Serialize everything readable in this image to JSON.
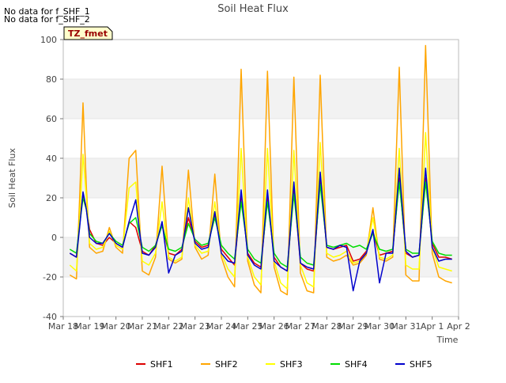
{
  "chart_data": {
    "type": "line",
    "title": "Soil Heat Flux",
    "xlabel": "Time",
    "ylabel": "Soil Heat Flux",
    "no_data_notes": [
      "No data for f_SHF_1",
      "No data for f_SHF_2"
    ],
    "tag": "TZ_fmet",
    "ylim": [
      -40,
      100
    ],
    "yticks": [
      -40,
      -20,
      0,
      20,
      40,
      60,
      80,
      100
    ],
    "xlim": [
      0,
      15
    ],
    "xticks": [
      {
        "label": "Mar 18",
        "day": 0
      },
      {
        "label": "Mar 19",
        "day": 1
      },
      {
        "label": "Mar 20",
        "day": 2
      },
      {
        "label": "Mar 21",
        "day": 3
      },
      {
        "label": "Mar 22",
        "day": 4
      },
      {
        "label": "Mar 23",
        "day": 5
      },
      {
        "label": "Mar 24",
        "day": 6
      },
      {
        "label": "Mar 25",
        "day": 7
      },
      {
        "label": "Mar 26",
        "day": 8
      },
      {
        "label": "Mar 27",
        "day": 9
      },
      {
        "label": "Mar 28",
        "day": 10
      },
      {
        "label": "Mar 29",
        "day": 11
      },
      {
        "label": "Mar 30",
        "day": 12
      },
      {
        "label": "Mar 31",
        "day": 13
      },
      {
        "label": "Apr 1",
        "day": 14
      },
      {
        "label": "Apr 2",
        "day": 15
      }
    ],
    "grid": "horizontal bands",
    "legend_position": "bottom",
    "series": [
      {
        "name": "SHF1",
        "color": "#dd0000",
        "x": [
          0.25,
          0.5,
          0.62,
          0.75,
          0.88,
          1.0,
          1.25,
          1.5,
          1.75,
          2.0,
          2.25,
          2.5,
          2.75,
          3.0,
          3.25,
          3.5,
          3.75,
          4.0,
          4.25,
          4.5,
          4.75,
          5.0,
          5.25,
          5.5,
          5.75,
          6.0,
          6.25,
          6.5,
          6.75,
          7.0,
          7.25,
          7.5,
          7.75,
          8.0,
          8.25,
          8.5,
          8.75,
          9.0,
          9.25,
          9.5,
          9.75,
          10.0,
          10.25,
          10.5,
          10.75,
          11.0,
          11.25,
          11.5,
          11.75,
          12.0,
          12.25,
          12.5,
          12.75,
          13.0,
          13.25,
          13.5,
          13.75,
          14.0,
          14.25,
          14.5,
          14.75
        ],
        "values": [
          -8,
          -10,
          8,
          22,
          15,
          4,
          -3,
          -4,
          0,
          -3,
          -5,
          8,
          5,
          -7,
          -9,
          -4,
          7,
          -8,
          -9,
          -6,
          10,
          -2,
          -5,
          -4,
          12,
          -6,
          -10,
          -14,
          22,
          -8,
          -13,
          -15,
          20,
          -10,
          -15,
          -17,
          25,
          -13,
          -16,
          -17,
          30,
          -5,
          -6,
          -5,
          -4,
          -12,
          -11,
          -7,
          3,
          -9,
          -8,
          -7,
          30,
          -8,
          -10,
          -9,
          30,
          -3,
          -10,
          -10,
          -11
        ]
      },
      {
        "name": "SHF2",
        "color": "#ffa500",
        "x": [
          0.25,
          0.5,
          0.62,
          0.75,
          0.88,
          1.0,
          1.25,
          1.5,
          1.75,
          2.0,
          2.25,
          2.5,
          2.75,
          3.0,
          3.25,
          3.5,
          3.75,
          4.0,
          4.25,
          4.5,
          4.75,
          5.0,
          5.25,
          5.5,
          5.75,
          6.0,
          6.25,
          6.5,
          6.75,
          7.0,
          7.25,
          7.5,
          7.75,
          8.0,
          8.25,
          8.5,
          8.75,
          9.0,
          9.25,
          9.5,
          9.75,
          10.0,
          10.25,
          10.5,
          10.75,
          11.0,
          11.25,
          11.5,
          11.75,
          12.0,
          12.25,
          12.5,
          12.75,
          13.0,
          13.25,
          13.5,
          13.75,
          14.0,
          14.25,
          14.5,
          14.75
        ],
        "values": [
          -19,
          -21,
          20,
          68,
          25,
          -5,
          -8,
          -7,
          5,
          -5,
          -8,
          40,
          44,
          -17,
          -19,
          -10,
          36,
          -11,
          -13,
          -11,
          34,
          -5,
          -11,
          -9,
          32,
          -10,
          -20,
          -25,
          85,
          -12,
          -24,
          -28,
          84,
          -15,
          -27,
          -29,
          81,
          -18,
          -27,
          -28,
          82,
          -10,
          -12,
          -11,
          -9,
          -14,
          -13,
          -9,
          15,
          -11,
          -12,
          -10,
          86,
          -19,
          -22,
          -22,
          97,
          -8,
          -20,
          -22,
          -23
        ]
      },
      {
        "name": "SHF3",
        "color": "#ffff00",
        "x": [
          0.25,
          0.5,
          0.62,
          0.75,
          0.88,
          1.0,
          1.25,
          1.5,
          1.75,
          2.0,
          2.25,
          2.5,
          2.75,
          3.0,
          3.25,
          3.5,
          3.75,
          4.0,
          4.25,
          4.5,
          4.75,
          5.0,
          5.25,
          5.5,
          5.75,
          6.0,
          6.25,
          6.5,
          6.75,
          7.0,
          7.25,
          7.5,
          7.75,
          8.0,
          8.25,
          8.5,
          8.75,
          9.0,
          9.25,
          9.5,
          9.75,
          10.0,
          10.25,
          10.5,
          10.75,
          11.0,
          11.25,
          11.5,
          11.75,
          12.0,
          12.25,
          12.5,
          12.75,
          13.0,
          13.25,
          13.5,
          13.75,
          14.0,
          14.25,
          14.5,
          14.75
        ],
        "values": [
          -14,
          -17,
          10,
          42,
          20,
          -3,
          -6,
          -5,
          3,
          -4,
          -6,
          25,
          28,
          -12,
          -14,
          -8,
          18,
          -10,
          -12,
          -10,
          20,
          -4,
          -8,
          -7,
          18,
          -8,
          -16,
          -20,
          45,
          -10,
          -20,
          -24,
          45,
          -12,
          -23,
          -26,
          44,
          -14,
          -23,
          -25,
          48,
          -8,
          -10,
          -9,
          -7,
          -13,
          -12,
          -8,
          10,
          -10,
          -11,
          -9,
          45,
          -14,
          -16,
          -16,
          53,
          -5,
          -15,
          -16,
          -17
        ]
      },
      {
        "name": "SHF4",
        "color": "#00dd00",
        "x": [
          0.25,
          0.5,
          0.62,
          0.75,
          0.88,
          1.0,
          1.25,
          1.5,
          1.75,
          2.0,
          2.25,
          2.5,
          2.75,
          3.0,
          3.25,
          3.5,
          3.75,
          4.0,
          4.25,
          4.5,
          4.75,
          5.0,
          5.25,
          5.5,
          5.75,
          6.0,
          6.25,
          6.5,
          6.75,
          7.0,
          7.25,
          7.5,
          7.75,
          8.0,
          8.25,
          8.5,
          8.75,
          9.0,
          9.25,
          9.5,
          9.75,
          10.0,
          10.25,
          10.5,
          10.75,
          11.0,
          11.25,
          11.5,
          11.75,
          12.0,
          12.25,
          12.5,
          12.75,
          13.0,
          13.25,
          13.5,
          13.75,
          14.0,
          14.25,
          14.5,
          14.75
        ],
        "values": [
          -6,
          -8,
          6,
          20,
          14,
          2,
          -2,
          -3,
          2,
          -2,
          -4,
          7,
          10,
          -5,
          -7,
          -4,
          6,
          -6,
          -7,
          -5,
          7,
          -1,
          -4,
          -3,
          10,
          -4,
          -8,
          -11,
          18,
          -6,
          -11,
          -13,
          18,
          -8,
          -13,
          -15,
          22,
          -10,
          -13,
          -14,
          27,
          -4,
          -5,
          -4,
          -3,
          -5,
          -4,
          -6,
          2,
          -6,
          -7,
          -6,
          28,
          -6,
          -8,
          -8,
          28,
          -2,
          -8,
          -9,
          -9
        ]
      },
      {
        "name": "SHF5",
        "color": "#0000cc",
        "x": [
          0.25,
          0.5,
          0.62,
          0.75,
          0.88,
          1.0,
          1.25,
          1.5,
          1.75,
          2.0,
          2.25,
          2.5,
          2.75,
          3.0,
          3.25,
          3.5,
          3.75,
          4.0,
          4.25,
          4.5,
          4.75,
          5.0,
          5.25,
          5.5,
          5.75,
          6.0,
          6.25,
          6.5,
          6.75,
          7.0,
          7.25,
          7.5,
          7.75,
          8.0,
          8.25,
          8.5,
          8.75,
          9.0,
          9.25,
          9.5,
          9.75,
          10.0,
          10.25,
          10.5,
          10.75,
          11.0,
          11.25,
          11.5,
          11.75,
          12.0,
          12.25,
          12.5,
          12.75,
          13.0,
          13.25,
          13.5,
          13.75,
          14.0,
          14.25,
          14.5,
          14.75
        ],
        "values": [
          -8,
          -10,
          5,
          23,
          14,
          0,
          -3,
          -3,
          2,
          -3,
          -5,
          8,
          19,
          -8,
          -9,
          -5,
          8,
          -18,
          -9,
          -7,
          15,
          -3,
          -6,
          -5,
          13,
          -8,
          -12,
          -13,
          24,
          -9,
          -14,
          -16,
          24,
          -12,
          -15,
          -17,
          28,
          -13,
          -15,
          -16,
          33,
          -5,
          -6,
          -4,
          -5,
          -27,
          -12,
          -8,
          4,
          -23,
          -8,
          -8,
          35,
          -7,
          -10,
          -9,
          35,
          -5,
          -12,
          -11,
          -11
        ]
      }
    ]
  }
}
